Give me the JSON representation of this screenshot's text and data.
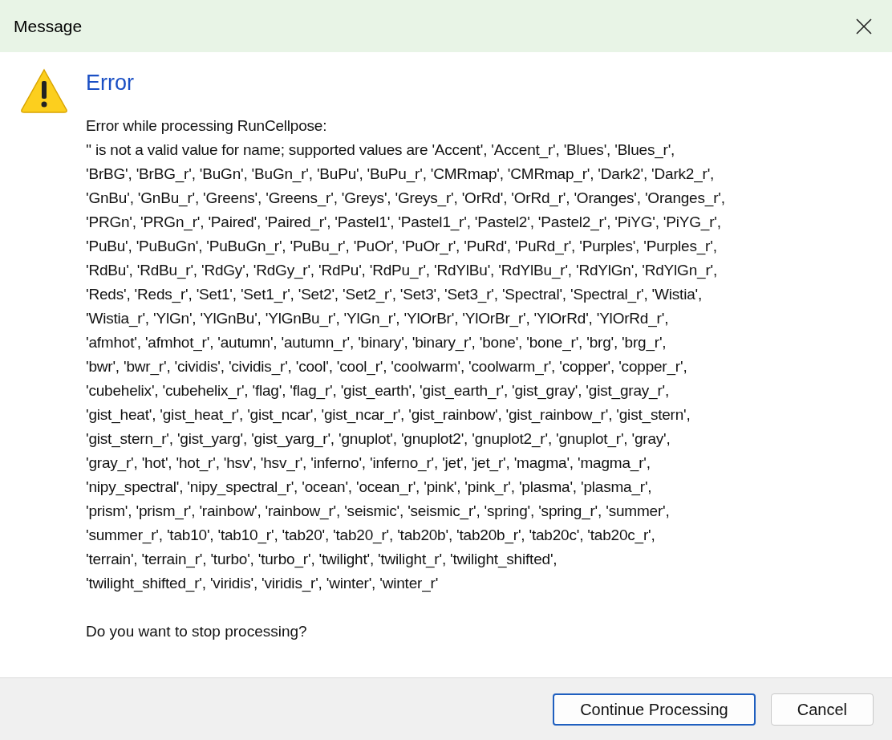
{
  "window": {
    "title": "Message"
  },
  "dialog": {
    "heading": "Error",
    "message_lines": [
      "Error while processing RunCellpose:",
      "'' is not a valid value for name; supported values are 'Accent', 'Accent_r', 'Blues', 'Blues_r',",
      "'BrBG', 'BrBG_r', 'BuGn', 'BuGn_r', 'BuPu', 'BuPu_r', 'CMRmap', 'CMRmap_r', 'Dark2', 'Dark2_r',",
      "'GnBu', 'GnBu_r', 'Greens', 'Greens_r', 'Greys', 'Greys_r', 'OrRd', 'OrRd_r', 'Oranges', 'Oranges_r',",
      "'PRGn', 'PRGn_r', 'Paired', 'Paired_r', 'Pastel1', 'Pastel1_r', 'Pastel2', 'Pastel2_r', 'PiYG', 'PiYG_r',",
      "'PuBu', 'PuBuGn', 'PuBuGn_r', 'PuBu_r', 'PuOr', 'PuOr_r', 'PuRd', 'PuRd_r', 'Purples', 'Purples_r',",
      "'RdBu', 'RdBu_r', 'RdGy', 'RdGy_r', 'RdPu', 'RdPu_r', 'RdYlBu', 'RdYlBu_r', 'RdYlGn', 'RdYlGn_r',",
      "'Reds', 'Reds_r', 'Set1', 'Set1_r', 'Set2', 'Set2_r', 'Set3', 'Set3_r', 'Spectral', 'Spectral_r', 'Wistia',",
      "'Wistia_r', 'YlGn', 'YlGnBu', 'YlGnBu_r', 'YlGn_r', 'YlOrBr', 'YlOrBr_r', 'YlOrRd', 'YlOrRd_r',",
      "'afmhot', 'afmhot_r', 'autumn', 'autumn_r', 'binary', 'binary_r', 'bone', 'bone_r', 'brg', 'brg_r',",
      "'bwr', 'bwr_r', 'cividis', 'cividis_r', 'cool', 'cool_r', 'coolwarm', 'coolwarm_r', 'copper', 'copper_r',",
      "'cubehelix', 'cubehelix_r', 'flag', 'flag_r', 'gist_earth', 'gist_earth_r', 'gist_gray', 'gist_gray_r',",
      "'gist_heat', 'gist_heat_r', 'gist_ncar', 'gist_ncar_r', 'gist_rainbow', 'gist_rainbow_r', 'gist_stern',",
      "'gist_stern_r', 'gist_yarg', 'gist_yarg_r', 'gnuplot', 'gnuplot2', 'gnuplot2_r', 'gnuplot_r', 'gray',",
      "'gray_r', 'hot', 'hot_r', 'hsv', 'hsv_r', 'inferno', 'inferno_r', 'jet', 'jet_r', 'magma', 'magma_r',",
      "'nipy_spectral', 'nipy_spectral_r', 'ocean', 'ocean_r', 'pink', 'pink_r', 'plasma', 'plasma_r',",
      "'prism', 'prism_r', 'rainbow', 'rainbow_r', 'seismic', 'seismic_r', 'spring', 'spring_r', 'summer',",
      "'summer_r', 'tab10', 'tab10_r', 'tab20', 'tab20_r', 'tab20b', 'tab20b_r', 'tab20c', 'tab20c_r',",
      "'terrain', 'terrain_r', 'turbo', 'turbo_r', 'twilight', 'twilight_r', 'twilight_shifted',",
      "'twilight_shifted_r', 'viridis', 'viridis_r', 'winter', 'winter_r'"
    ],
    "question": "Do you want to stop processing?"
  },
  "buttons": [
    {
      "label": "Continue Processing",
      "default": true
    },
    {
      "label": "Cancel",
      "default": false
    }
  ]
}
